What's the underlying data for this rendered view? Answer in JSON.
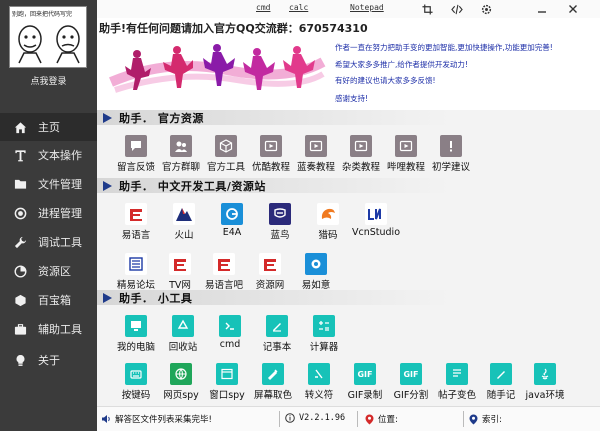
{
  "sidebar": {
    "avatar_caption": "别跑，回来把代码写完",
    "login": "点我登录",
    "items": [
      {
        "label": "主页",
        "icon": "home-icon"
      },
      {
        "label": "文本操作",
        "icon": "text-icon"
      },
      {
        "label": "文件管理",
        "icon": "folder-icon"
      },
      {
        "label": "进程管理",
        "icon": "process-icon"
      },
      {
        "label": "调试工具",
        "icon": "wrench-icon"
      },
      {
        "label": "资源区",
        "icon": "chart-icon"
      },
      {
        "label": "百宝箱",
        "icon": "box-icon"
      },
      {
        "label": "辅助工具",
        "icon": "briefcase-icon"
      },
      {
        "label": "关于",
        "icon": "lightbulb-icon"
      }
    ]
  },
  "topbar": {
    "links": [
      "cmd",
      "calc",
      "Notepad"
    ],
    "icons": [
      "crop-icon",
      "code-icon",
      "settings-icon",
      "minimize-icon",
      "close-icon"
    ]
  },
  "banner": {
    "marquee": "助手!有任何问题请加入官方QQ交流群：670574310",
    "lines": [
      "作者一直在努力把助手变的更加智能,更加快捷操作,功能更加完善!",
      "希望大家多多推广,给作者提供开发动力!",
      "有好的建议也请大家多多反馈!",
      "感谢支持!"
    ]
  },
  "sections": {
    "official": {
      "title": "助手． 官方资源",
      "tools": [
        "留言反馈",
        "官方群聊",
        "官方工具",
        "优酷教程",
        "蓝奏教程",
        "杂类教程",
        "哔哩教程",
        "初学建议"
      ]
    },
    "dev": {
      "title": "助手． 中文开发工具/资源站",
      "tools": [
        "易语言",
        "火山",
        "E4A",
        "蓝鸟",
        "猎码",
        "VcnStudio",
        "精易论坛",
        "TV网",
        "易语言吧",
        "资源网",
        "易如意"
      ]
    },
    "small": {
      "title": "助手． 小工具",
      "tools": [
        "我的电脑",
        "回收站",
        "cmd",
        "记事本",
        "计算器",
        "按键码",
        "网页spy",
        "窗口spy",
        "屏幕取色",
        "转义符",
        "GIF录制",
        "GIF分割",
        "帖子变色",
        "随手记",
        "java环境"
      ]
    }
  },
  "statusbar": {
    "message": "解答区文件列表采集完毕!",
    "version": "V2.2.1.96",
    "position_label": "位置:",
    "index_label": "索引:"
  },
  "colors": {
    "sidebar_bg": "#3b3b3b",
    "banner_text": "#1e2fa8",
    "section_arrow": "#1e3a8a"
  }
}
